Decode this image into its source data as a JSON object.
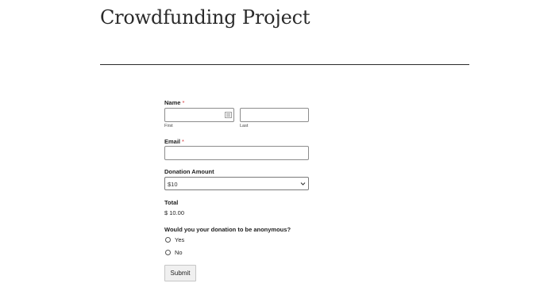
{
  "page": {
    "title": "Crowdfunding Project"
  },
  "form": {
    "name": {
      "label": "Name",
      "required_mark": "*",
      "first_label": "First",
      "last_label": "Last",
      "first_value": "",
      "last_value": "",
      "icon": "contact-card-icon"
    },
    "email": {
      "label": "Email",
      "required_mark": "*",
      "value": ""
    },
    "donation": {
      "label": "Donation Amount",
      "selected": "$10",
      "icon": "chevron-down-icon"
    },
    "total": {
      "label": "Total",
      "value": "$ 10.00"
    },
    "anonymous": {
      "question": "Would you your donation to be anonymous?",
      "options": [
        {
          "label": "Yes",
          "selected": false
        },
        {
          "label": "No",
          "selected": false
        }
      ]
    },
    "submit_label": "Submit"
  }
}
